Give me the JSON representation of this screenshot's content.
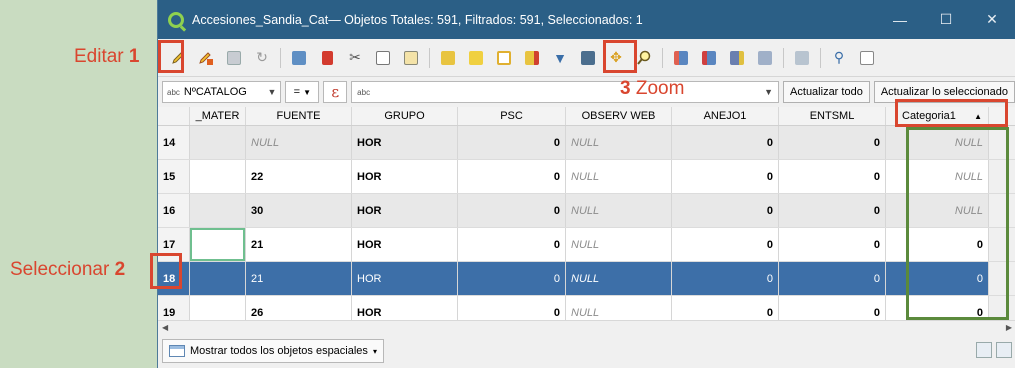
{
  "annotations": {
    "edit": {
      "text": "Editar",
      "num": "1"
    },
    "select": {
      "text": "Seleccionar",
      "num": "2"
    },
    "zoom": {
      "num": "3",
      "text": "Zoom"
    }
  },
  "window": {
    "title": "Accesiones_Sandia_Cat— Objetos Totales: 591, Filtrados: 591, Seleccionados: 1",
    "controls": [
      "—",
      "☐",
      "✕"
    ]
  },
  "toolbar_icons": [
    "edit-pencil-icon",
    "multi-edit-icon",
    "save-icon",
    "reload-icon",
    "add-feature-icon",
    "delete-icon",
    "cut-icon",
    "copy-icon",
    "paste-icon",
    "expression-select-icon",
    "select-all-icon",
    "invert-selection-icon",
    "deselect-icon",
    "move-selection-top-icon",
    "filter-icon",
    "pan-to-selection-icon",
    "zoom-to-selection-icon",
    "copy-rows-icon",
    "paste-rows-icon",
    "field-calculator-icon",
    "conditional-format-icon",
    "dock-icon",
    "actions-icon",
    "form-view-icon"
  ],
  "filter": {
    "field_prefix": "abc",
    "field": "NºCATALOG",
    "operator": "=",
    "expr_symbol": "ε",
    "value_prefix": "abc",
    "value": "",
    "update_all": "Actualizar todo",
    "update_selected": "Actualizar lo seleccionado"
  },
  "table": {
    "columns": [
      "_MATER",
      "FUENTE",
      "GRUPO",
      "PSC",
      "OBSERV WEB",
      "ANEJO1",
      "ENTSML",
      "Categoria1"
    ],
    "sort_indicator": "▲",
    "rows": [
      {
        "n": "14",
        "mater": "",
        "fuente": "NULL",
        "grupo": "HOR",
        "psc": "0",
        "obs": "NULL",
        "anejo": "0",
        "entsml": "0",
        "cat": "NULL"
      },
      {
        "n": "15",
        "mater": "",
        "fuente": "22",
        "grupo": "HOR",
        "psc": "0",
        "obs": "NULL",
        "anejo": "0",
        "entsml": "0",
        "cat": "NULL"
      },
      {
        "n": "16",
        "mater": "",
        "fuente": "30",
        "grupo": "HOR",
        "psc": "0",
        "obs": "NULL",
        "anejo": "0",
        "entsml": "0",
        "cat": "NULL"
      },
      {
        "n": "17",
        "mater": "",
        "fuente": "21",
        "grupo": "HOR",
        "psc": "0",
        "obs": "NULL",
        "anejo": "0",
        "entsml": "0",
        "cat": "0"
      },
      {
        "n": "18",
        "mater": "",
        "fuente": "21",
        "grupo": "HOR",
        "psc": "0",
        "obs": "NULL",
        "anejo": "0",
        "entsml": "0",
        "cat": "0"
      },
      {
        "n": "19",
        "mater": "",
        "fuente": "26",
        "grupo": "HOR",
        "psc": "0",
        "obs": "NULL",
        "anejo": "0",
        "entsml": "0",
        "cat": "0"
      }
    ]
  },
  "status": {
    "show_all": "Mostrar todos los objetos espaciales"
  },
  "colors": {
    "highlight_red": "#d9462f",
    "highlight_green": "#5b8a3c",
    "selected_row": "#3d6fa8",
    "titlebar": "#2b5f86"
  }
}
